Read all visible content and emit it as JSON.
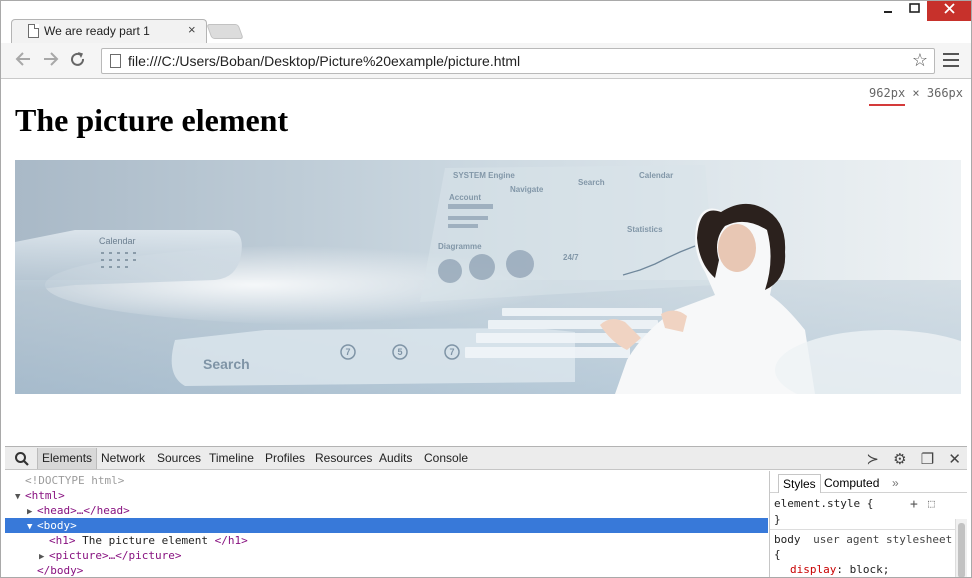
{
  "browser": {
    "tab_title": "We are ready part 1",
    "tab_close": "×",
    "url": "file:///C:/Users/Boban/Desktop/Picture%20example/picture.html",
    "window_controls": {
      "minimize": "▬",
      "maximize": "□",
      "close": "✕"
    }
  },
  "toolbar": {
    "back_icon": "arrow-left",
    "forward_icon": "arrow-right",
    "reload_icon": "reload",
    "bookmark_icon": "star",
    "menu_icon": "hamburger"
  },
  "viewport": {
    "width_readout": "962px",
    "times": "×",
    "height_readout": "366px",
    "heading": "The picture element"
  },
  "hero": {
    "labels": {
      "system_engine": "SYSTEM Engine",
      "account": "Account",
      "navigate": "Navigate",
      "search_top": "Search",
      "calendar_top": "Calendar",
      "statistics": "Statistics",
      "diagramme": "Diagramme",
      "calendar_left": "Calendar",
      "search_bottom": "Search",
      "num1": "7",
      "num2": "5",
      "num3": "7",
      "sevdays": "24/7"
    }
  },
  "devtools": {
    "tabs": [
      "Elements",
      "Network",
      "Sources",
      "Timeline",
      "Profiles",
      "Resources",
      "Audits",
      "Console"
    ],
    "dom": {
      "doctype": "<!DOCTYPE html>",
      "html_open": "<html>",
      "head": "<head>…</head>",
      "body_open": "<body>",
      "h1_open": "<h1>",
      "h1_text": " The picture element ",
      "h1_close": "</h1>",
      "picture": "<picture>…</picture>",
      "body_close": "</body>"
    },
    "styles": {
      "tab_styles": "Styles",
      "tab_computed": "Computed",
      "more": "»",
      "element_style": "element.style {",
      "close_brace": "}",
      "body_selector": "body",
      "source": "user agent stylesheet",
      "open_brace": "{",
      "prop": "display",
      "value": "block;"
    }
  },
  "colors": {
    "accent_selection": "#3879d9",
    "tag": "#881280",
    "close_button": "#c7312b",
    "dimension_underline": "#d43a3a"
  }
}
